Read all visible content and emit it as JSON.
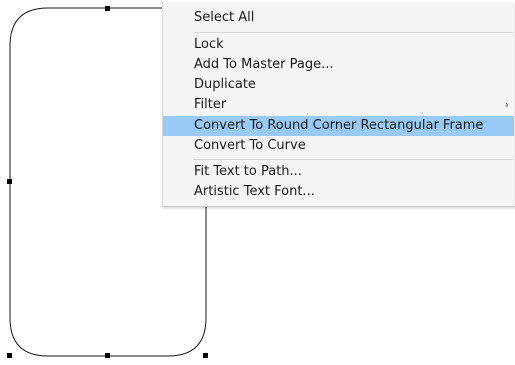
{
  "canvas": {
    "shape_name": "round-corner-rectangle",
    "stroke_color": "#1a1a1a",
    "handle_color": "#000000"
  },
  "context_menu": {
    "highlight_color": "#99c9f5",
    "items": [
      {
        "label": "Select All"
      },
      {
        "label": "Lock"
      },
      {
        "label": "Add To Master Page..."
      },
      {
        "label": "Duplicate"
      },
      {
        "label": "Filter",
        "submenu_icon": "chevron-right-icon",
        "submenu_glyph": "›"
      },
      {
        "label": "Convert To Round Corner Rectangular Frame",
        "highlighted": true
      },
      {
        "label": "Convert To Curve"
      },
      {
        "label": "Fit Text to Path..."
      },
      {
        "label": "Artistic Text Font..."
      }
    ]
  }
}
